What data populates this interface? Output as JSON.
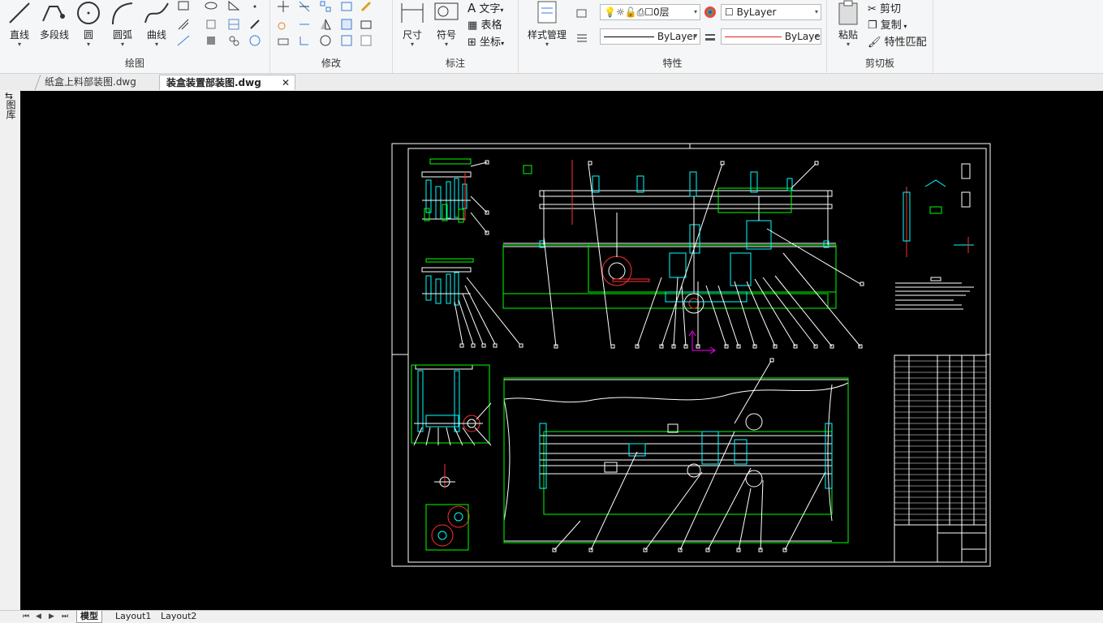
{
  "ribbon": {
    "draw": {
      "title": "绘图",
      "tools": [
        "直线",
        "多段线",
        "圆",
        "圆弧",
        "曲线"
      ]
    },
    "modify": {
      "title": "修改"
    },
    "annotate": {
      "title": "标注",
      "dimension": "尺寸",
      "symbol": "符号",
      "text": "文字",
      "table": "表格",
      "coordinate": "坐标"
    },
    "properties": {
      "title": "特性",
      "style_manager": "样式管理",
      "layer": "0层",
      "color": "ByLayer",
      "linetype": "ByLayer",
      "lineweight": "ByLaye"
    },
    "clipboard": {
      "title": "剪切板",
      "paste": "粘贴",
      "cut": "剪切",
      "copy": "复制",
      "match": "特性匹配"
    }
  },
  "tabs": [
    {
      "label": "纸盒上料部装图.dwg",
      "active": false
    },
    {
      "label": "装盒装置部装图.dwg",
      "active": true
    }
  ],
  "left_strip": {
    "label": "图库"
  },
  "layouts": [
    {
      "label": "模型",
      "active": true
    },
    {
      "label": "Layout1",
      "active": false
    },
    {
      "label": "Layout2",
      "active": false
    }
  ],
  "colors": {
    "canvas_bg": "#000000",
    "drawing_white": "#ffffff",
    "dim_green": "#00ff00",
    "part_cyan": "#00ffff",
    "red": "#ff3030",
    "ucs_magenta": "#ff00ff"
  }
}
